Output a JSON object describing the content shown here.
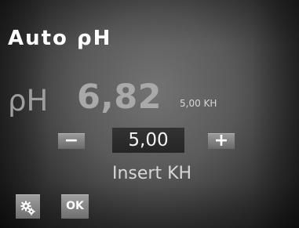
{
  "screen": {
    "title": "Auto ρH",
    "ph_label": "ρH",
    "ph_value": "6,82",
    "reference_kh": "5,00 KH",
    "kh_input_value": "5,00",
    "instruction": "Insert KH"
  },
  "controls": {
    "decrease_label": "−",
    "increase_label": "+",
    "ok_label": "OK",
    "settings_icon": "gears-icon"
  }
}
